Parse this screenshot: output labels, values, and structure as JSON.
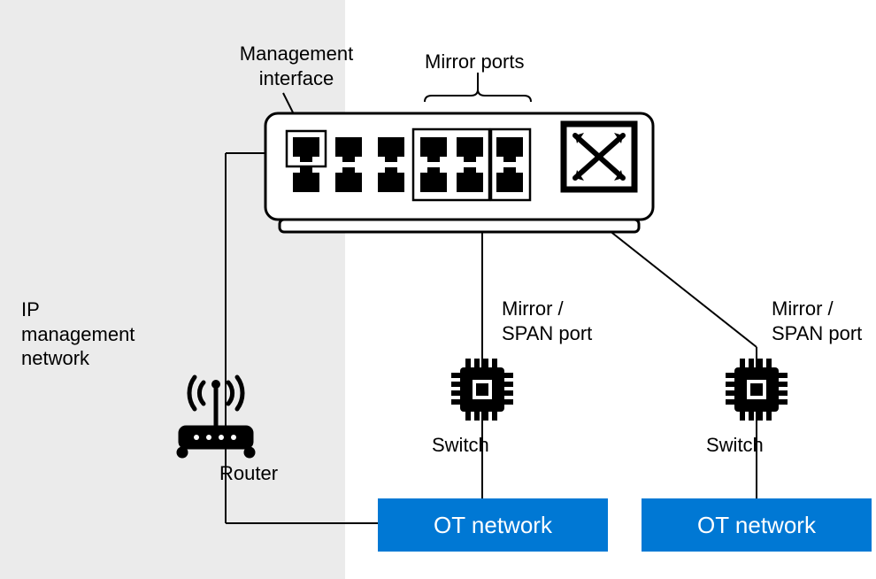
{
  "labels": {
    "management_interface": "Management\ninterface",
    "mirror_ports": "Mirror ports",
    "ip_management_network": "IP\nmanagement\nnetwork",
    "router": "Router",
    "mirror_span_port_1": "Mirror /\nSPAN port",
    "mirror_span_port_2": "Mirror /\nSPAN port",
    "switch_1": "Switch",
    "switch_2": "Switch",
    "ot_network_1": "OT network",
    "ot_network_2": "OT network"
  },
  "colors": {
    "accent_blue": "#0078d4",
    "grey_bg": "#ebebeb"
  }
}
